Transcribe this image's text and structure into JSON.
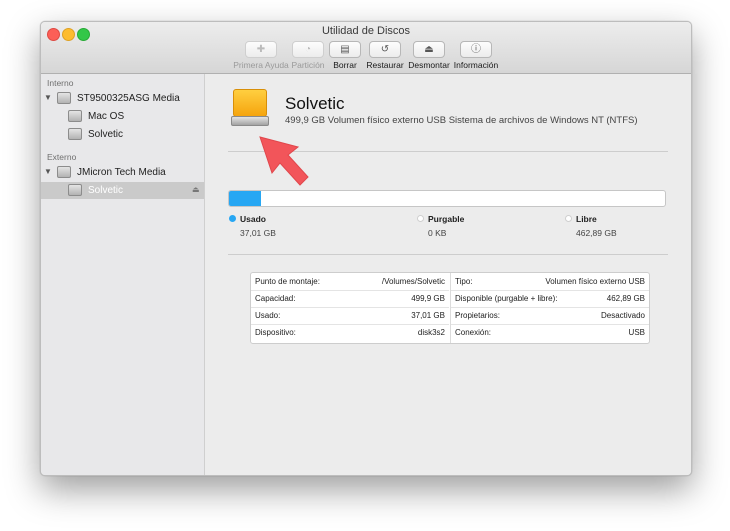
{
  "window": {
    "title": "Utilidad de Discos"
  },
  "toolbar": {
    "buttons": [
      {
        "label": "Primera Ayuda",
        "icon": "first-aid-icon",
        "enabled": false
      },
      {
        "label": "Partición",
        "icon": "partition-icon",
        "enabled": false
      },
      {
        "label": "Borrar",
        "icon": "erase-icon",
        "enabled": true
      },
      {
        "label": "Restaurar",
        "icon": "restore-icon",
        "enabled": true
      },
      {
        "label": "Desmontar",
        "icon": "unmount-icon",
        "enabled": true
      },
      {
        "label": "Información",
        "icon": "info-icon",
        "enabled": true
      }
    ]
  },
  "sidebar": {
    "internal_header": "Interno",
    "external_header": "Externo",
    "internal_disk": "ST9500325ASG Media",
    "internal_volumes": [
      "Mac OS",
      "Solvetic"
    ],
    "external_disk": "JMicron Tech Media",
    "external_volume": "Solvetic"
  },
  "volume": {
    "name": "Solvetic",
    "description": "499,9 GB Volumen físico externo USB Sistema de archivos de Windows NT (NTFS)",
    "icon": "external-drive-icon"
  },
  "usage": {
    "used_fraction": 0.074,
    "used_label": "Usado",
    "used_value": "37,01 GB",
    "purgeable_label": "Purgable",
    "purgeable_value": "0 KB",
    "free_label": "Libre",
    "free_value": "462,89 GB",
    "colors": {
      "used": "#27a7f3",
      "purgeable": "#ffffff",
      "free": "#ffffff"
    }
  },
  "info": {
    "left": [
      {
        "key": "Punto de montaje:",
        "value": "/Volumes/Solvetic"
      },
      {
        "key": "Capacidad:",
        "value": "499,9 GB"
      },
      {
        "key": "Usado:",
        "value": "37,01 GB"
      },
      {
        "key": "Dispositivo:",
        "value": "disk3s2"
      }
    ],
    "right": [
      {
        "key": "Tipo:",
        "value": "Volumen físico externo USB"
      },
      {
        "key": "Disponible (purgable + libre):",
        "value": "462,89 GB"
      },
      {
        "key": "Propietarios:",
        "value": "Desactivado"
      },
      {
        "key": "Conexión:",
        "value": "USB"
      }
    ]
  },
  "colors": {
    "annotation_arrow": "#f2555a",
    "used_bar": "#27a7f3",
    "selection": "#cacaca"
  }
}
